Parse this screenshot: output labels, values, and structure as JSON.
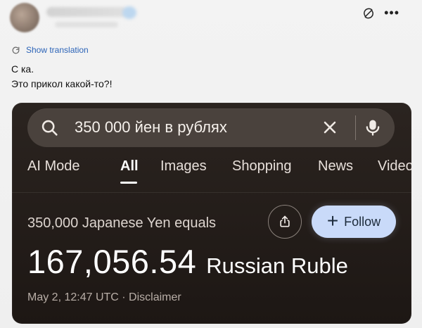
{
  "post": {
    "translation_label": "Show translation",
    "text_lines": [
      "С ка.",
      "Это прикол какой-то?!"
    ]
  },
  "embed": {
    "search": {
      "query": "350 000 йен в рублях"
    },
    "tabs": [
      {
        "label": "AI Mode"
      },
      {
        "label": "All"
      },
      {
        "label": "Images"
      },
      {
        "label": "Shopping"
      },
      {
        "label": "News"
      },
      {
        "label": "Videos"
      }
    ],
    "result": {
      "label": "350,000 Japanese Yen equals",
      "amount": "167,056.54",
      "currency": "Russian Ruble",
      "meta": "May 2, 12:47 UTC · Disclaimer"
    },
    "buttons": {
      "follow": "Follow"
    }
  },
  "icons": {
    "translate": "refresh-icon",
    "top_action_1": "grok-icon",
    "top_action_2": "more-icon",
    "search": "search-icon",
    "clear": "close-icon",
    "mic": "microphone-icon",
    "share": "share-icon",
    "plus": "plus-icon"
  }
}
